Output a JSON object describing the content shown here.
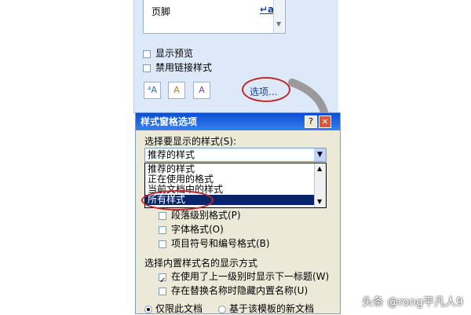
{
  "styles_pane": {
    "list_item": "页脚",
    "list_item_marker": "↵a",
    "show_preview": "显示预览",
    "disable_linked": "禁用链接样式",
    "tool_new": "⁴A",
    "tool_inspect": "A",
    "tool_manage": "A",
    "options_link": "选项..."
  },
  "dialog": {
    "title": "样式窗格选项",
    "help_btn": "?",
    "close_btn": "×",
    "select_label": "选择要显示的样式(S):",
    "combo_value": "推荐的样式",
    "options": [
      "推荐的样式",
      "正在使用的格式",
      "当前文档中的样式",
      "所有样式"
    ],
    "selected_option": "所有样式",
    "fmt_paragraph": "段落级别格式(P)",
    "fmt_font": "字体格式(O)",
    "fmt_bullets": "项目符号和编号格式(B)",
    "builtin_label": "选择内置样式名的显示方式",
    "builtin_opt1": "在使用了上一级别时显示下一标题(W)",
    "builtin_opt2": "存在替换名称时隐藏内置名称(U)",
    "radio_doc": "仅限此文档",
    "radio_template": "基于该模板的新文档"
  },
  "watermark": "头条 @rong平凡人9",
  "colors": {
    "highlight": "#0a246a",
    "annotation": "#c0282c",
    "titlebar": "#0a4fd1"
  }
}
